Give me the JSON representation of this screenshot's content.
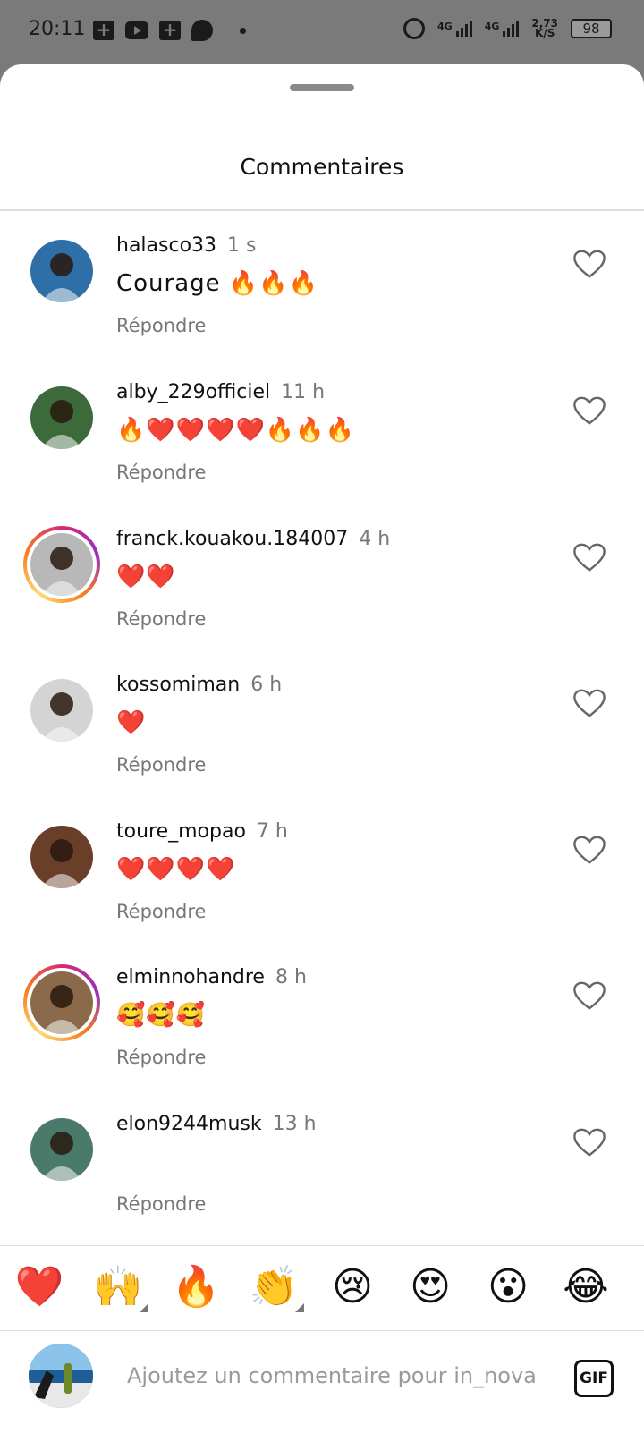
{
  "status_bar": {
    "time": "20:11",
    "network1": "4G",
    "network2": "4G",
    "speed_value": "2,73",
    "speed_unit": "K/S",
    "battery": "98"
  },
  "sheet": {
    "title": "Commentaires"
  },
  "reply_label": "Répondre",
  "comments": [
    {
      "username": "halasco33",
      "time": "1 s",
      "text": "Courage 🔥🔥🔥",
      "ring": false,
      "avatar_color": "#2f6fa8"
    },
    {
      "username": "alby_229officiel",
      "time": "11 h",
      "text": "🔥❤️❤️❤️❤️🔥🔥🔥",
      "ring": false,
      "avatar_color": "#3c6a3a"
    },
    {
      "username": "franck.kouakou.184007",
      "time": "4 h",
      "text": "❤️❤️",
      "ring": true,
      "avatar_color": "#b8b8b8"
    },
    {
      "username": "kossomiman",
      "time": "6 h",
      "text": "❤️",
      "ring": false,
      "avatar_color": "#d4d4d4"
    },
    {
      "username": "toure_mopao",
      "time": "7 h",
      "text": "❤️❤️❤️❤️",
      "ring": false,
      "avatar_color": "#6a3f2a"
    },
    {
      "username": "elminnohandre",
      "time": "8 h",
      "text": "🥰🥰🥰",
      "ring": true,
      "avatar_color": "#8a6a4a"
    },
    {
      "username": "elon9244musk",
      "time": "13 h",
      "text": "",
      "ring": false,
      "avatar_color": "#4a7a6a"
    }
  ],
  "reactions": [
    "❤️",
    "🙌",
    "🔥",
    "👏",
    "😢",
    "😍",
    "😮",
    "😂"
  ],
  "composer": {
    "placeholder": "Ajoutez un commentaire pour in_nova",
    "gif_label": "GIF"
  }
}
